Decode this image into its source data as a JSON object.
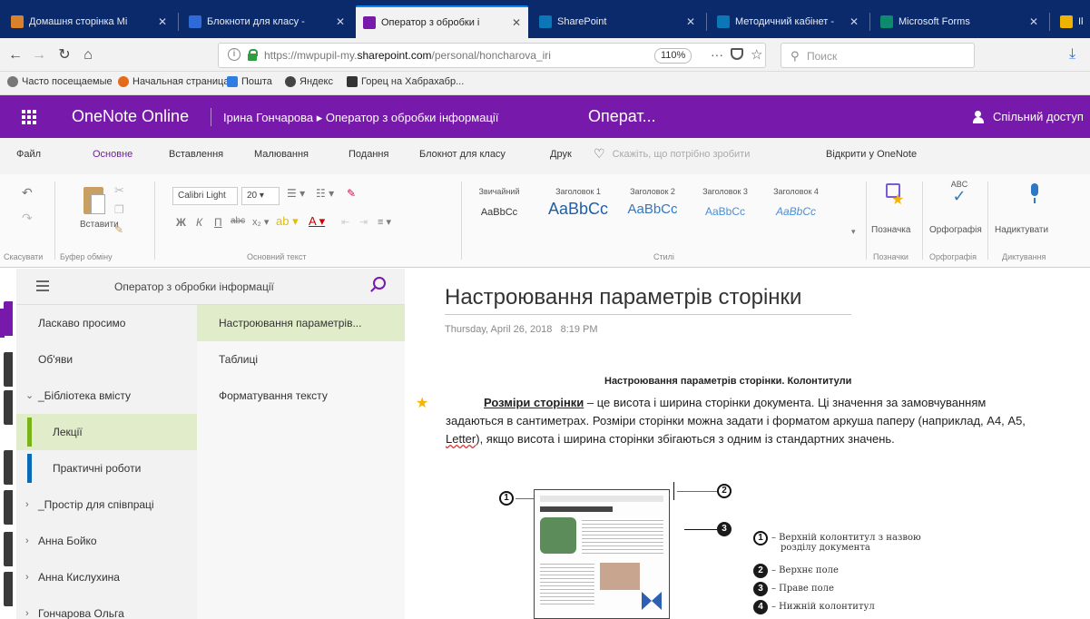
{
  "browser": {
    "tabs": [
      {
        "label": "Домашня сторінка Mi",
        "color": "#d9822b",
        "active": false
      },
      {
        "label": "Блокноти для класу -",
        "color": "#2e6bd6",
        "active": false
      },
      {
        "label": "Оператор з обробки і",
        "color": "#7719aa",
        "active": true
      },
      {
        "label": "SharePoint",
        "color": "#0b77b7",
        "active": false
      },
      {
        "label": "Методичний кабінет -",
        "color": "#0b77b7",
        "active": false
      },
      {
        "label": "Microsoft Forms",
        "color": "#0e8a6f",
        "active": false
      },
      {
        "label": "Ik",
        "color": "#f0b400",
        "active": false
      }
    ],
    "url_prefix": "https://mwpupil-my.",
    "url_domain": "sharepoint.com",
    "url_suffix": "/personal/honcharova_iri",
    "zoom": "110%",
    "search_placeholder": "Поиск",
    "bookmarks": [
      {
        "label": "Часто посещаемые",
        "color": "#777"
      },
      {
        "label": "Начальная страница",
        "color": "#e36a1b"
      },
      {
        "label": "Пошта",
        "color": "#2f7de1"
      },
      {
        "label": "Яндекс",
        "color": "#444"
      },
      {
        "label": "Горец на Хабрахабр...",
        "color": "#333"
      }
    ]
  },
  "app": {
    "title": "OneNote Online",
    "breadcrumb": "Ірина Гончарова ▸ Оператор з обробки інформації",
    "page_chip": "Операт...",
    "share_label": "Спільний доступ"
  },
  "ribbon_tabs": [
    "Файл",
    "Основне",
    "Вставлення",
    "Малювання",
    "Подання",
    "Блокнот для класу",
    "Друк",
    "Скажіть, що потрібно зробити",
    "Відкрити у OneNote"
  ],
  "ribbon": {
    "undo_group": "Скасувати",
    "paste_label": "Вставити",
    "clipboard_group": "Буфер обміну",
    "font_name": "Calibri Light",
    "font_size": "20",
    "basic_text_group": "Основний текст",
    "styles": [
      {
        "name": "Звичайний",
        "preview": "AaBbCc"
      },
      {
        "name": "Заголовок 1",
        "preview": "AaBbCc"
      },
      {
        "name": "Заголовок 2",
        "preview": "AaBbCc"
      },
      {
        "name": "Заголовок 3",
        "preview": "AaBbCc"
      },
      {
        "name": "Заголовок 4",
        "preview": "AaBbCc"
      }
    ],
    "styles_group": "Стилі",
    "tag_label": "Позначка",
    "tags_group": "Позначки",
    "spell_label": "Орфографія",
    "spell_group": "Орфографія",
    "dictate_label": "Надиктувати",
    "dictate_group": "Диктування"
  },
  "nav": {
    "notebook_title": "Оператор з обробки інформації",
    "sections": [
      {
        "label": "Ласкаво просимо",
        "bar": "#7719aa",
        "chev": ""
      },
      {
        "label": "Об'яви",
        "bar": "",
        "chev": ""
      },
      {
        "label": "_Бібліотека вмісту",
        "bar": "",
        "chev": "v"
      },
      {
        "label": "Лекції",
        "bar": "#7ab317",
        "chev": "",
        "selected": true
      },
      {
        "label": "Практичні роботи",
        "bar": "#0b6ab5",
        "chev": ""
      },
      {
        "label": "_Простір для співпраці",
        "bar": "",
        "chev": ">"
      },
      {
        "label": "Анна Бойко",
        "bar": "",
        "chev": ">"
      },
      {
        "label": "Анна Кислухина",
        "bar": "",
        "chev": ">"
      },
      {
        "label": "Гончарова Ольга",
        "bar": "",
        "chev": ">"
      }
    ],
    "pages": [
      {
        "label": "Настроювання параметрів...",
        "selected": true
      },
      {
        "label": "Таблиці",
        "selected": false
      },
      {
        "label": "Форматування тексту",
        "selected": false
      }
    ]
  },
  "page": {
    "title": "Настроювання параметрів сторінки",
    "date": "Thursday, April 26, 2018",
    "time": "8:19 PM",
    "section_heading": "Настроювання параметрів сторінки. Колонтитули",
    "body_term": "Розміри сторінки",
    "body_part1": " – це висота і ширина сторінки документа. Ці значення за замовчуванням задаються в сантиметрах. Розміри сторінки можна задати і форматом аркуша паперу (наприклад, А4, А5, ",
    "body_letter": "Letter",
    "body_part2": "), якщо висота і ширина сторінки збігаються з одним із стандартних значень.",
    "figure_legend": [
      {
        "num": "1",
        "text": "– Верхній колонтитул з назвою",
        "text2": "розділу документа"
      },
      {
        "num": "2",
        "text": "– Верхнє поле",
        "text2": ""
      },
      {
        "num": "3",
        "text": "– Праве поле",
        "text2": ""
      },
      {
        "num": "4",
        "text": "– Нижній колонтитул",
        "text2": ""
      }
    ]
  }
}
